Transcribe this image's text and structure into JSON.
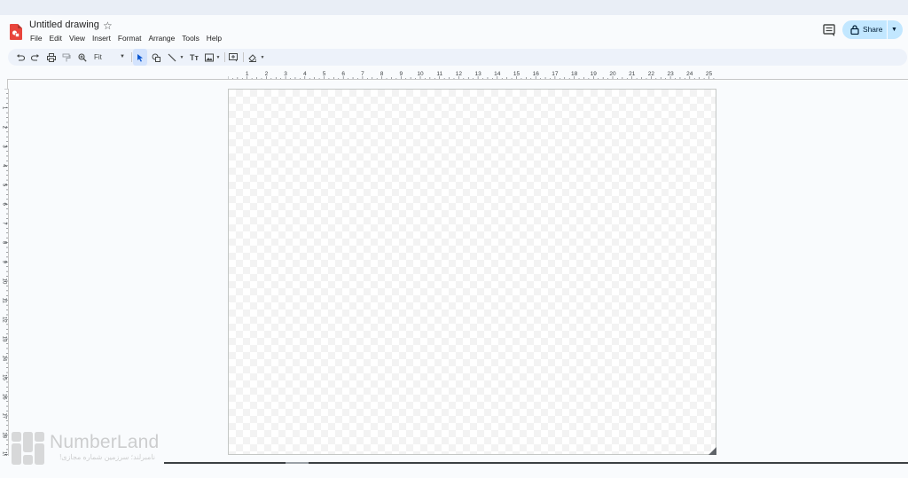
{
  "app": {
    "title": "Untitled drawing",
    "icon": "drawings-logo-icon",
    "accent_color": "#e8453c"
  },
  "menu": [
    "File",
    "Edit",
    "View",
    "Insert",
    "Format",
    "Arrange",
    "Tools",
    "Help"
  ],
  "header_actions": {
    "comment_icon": "comment-history-icon",
    "share_label": "Share",
    "share_icon": "lock-icon",
    "share_color": "#c2e7ff"
  },
  "toolbar": {
    "buttons": [
      "undo-icon",
      "redo-icon",
      "print-icon",
      "paint-format-icon",
      "zoom-icon",
      "select-icon",
      "shape-icon",
      "line-icon",
      "textbox-icon",
      "image-icon",
      "comment-add-icon",
      "background-icon"
    ],
    "zoom_value": "Fit",
    "active_tool": "select-icon"
  },
  "ruler": {
    "horizontal_labels": [
      "1",
      "2",
      "3",
      "4",
      "5",
      "6",
      "7",
      "8",
      "9",
      "10",
      "11",
      "12",
      "13",
      "14",
      "15",
      "16",
      "17",
      "18",
      "19",
      "20",
      "21",
      "22",
      "23",
      "24",
      "25"
    ],
    "vertical_labels": [
      "1",
      "2",
      "3",
      "4",
      "5",
      "6",
      "7",
      "8",
      "9",
      "10",
      "11",
      "12",
      "13",
      "14",
      "15",
      "16",
      "17",
      "18",
      "19"
    ]
  },
  "canvas": {
    "background": "transparent-checker"
  },
  "watermark": {
    "name": "NumberLand",
    "tagline": "نامبرلند؛ سرزمین شماره مجازی!"
  }
}
